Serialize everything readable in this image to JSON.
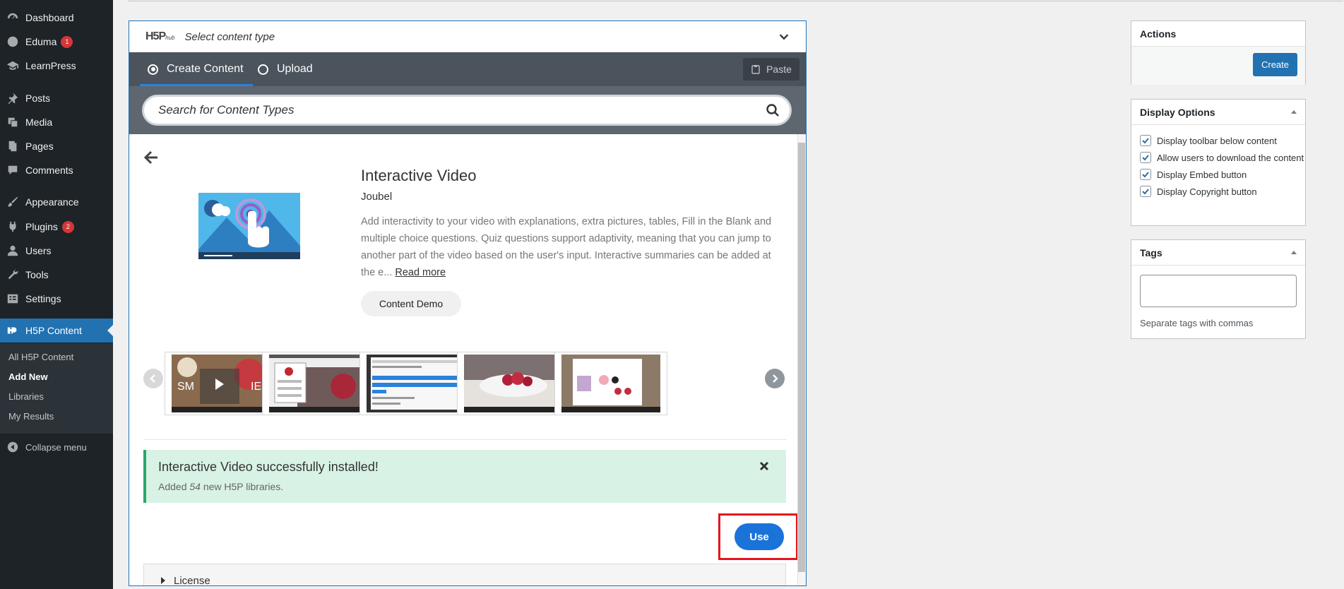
{
  "sidebar": {
    "items": [
      {
        "label": "Dashboard",
        "icon": "dashboard-icon"
      },
      {
        "label": "Eduma",
        "icon": "eduma-icon",
        "badge": "1"
      },
      {
        "label": "LearnPress",
        "icon": "learnpress-icon"
      },
      {
        "label": "Posts",
        "icon": "pin-icon"
      },
      {
        "label": "Media",
        "icon": "media-icon"
      },
      {
        "label": "Pages",
        "icon": "pages-icon"
      },
      {
        "label": "Comments",
        "icon": "comments-icon"
      },
      {
        "label": "Appearance",
        "icon": "brush-icon"
      },
      {
        "label": "Plugins",
        "icon": "plug-icon",
        "badge": "2"
      },
      {
        "label": "Users",
        "icon": "users-icon"
      },
      {
        "label": "Tools",
        "icon": "wrench-icon"
      },
      {
        "label": "Settings",
        "icon": "settings-icon"
      },
      {
        "label": "H5P Content",
        "icon": "h5p-icon"
      }
    ],
    "submenu": [
      "All H5P Content",
      "Add New",
      "Libraries",
      "My Results"
    ],
    "collapse_label": "Collapse menu"
  },
  "hub": {
    "logo_text": "H5P",
    "logo_sub": "hub",
    "title": "Select content type",
    "tabs": [
      {
        "label": "Create Content",
        "selected": true
      },
      {
        "label": "Upload",
        "selected": false
      }
    ],
    "paste_label": "Paste",
    "search_placeholder": "Search for Content Types"
  },
  "detail": {
    "title": "Interactive Video",
    "owner": "Joubel",
    "description": "Add interactivity to your video with explanations, extra pictures, tables, Fill in the Blank and multiple choice questions. Quiz questions support adaptivity, meaning that you can jump to another part of the video based on the user's input. Interactive summaries can be added at the e...",
    "read_more": "Read more",
    "demo_label": "Content Demo",
    "notice_title": "Interactive Video successfully installed!",
    "notice_prefix": "Added ",
    "notice_count": "54",
    "notice_suffix": " new H5P libraries.",
    "use_label": "Use",
    "license_label": "License"
  },
  "panels": {
    "actions_title": "Actions",
    "create_label": "Create",
    "display_title": "Display Options",
    "options": [
      {
        "label": "Display toolbar below content",
        "checked": true
      },
      {
        "label": "Allow users to download the content",
        "checked": true
      },
      {
        "label": "Display Embed button",
        "checked": true
      },
      {
        "label": "Display Copyright button",
        "checked": true
      }
    ],
    "tags_title": "Tags",
    "tags_hint": "Separate tags with commas"
  },
  "colors": {
    "sidebar_bg": "#1d2327",
    "accent": "#2271b1",
    "success_bg": "#d8f2e5",
    "highlight": "#e5151d",
    "use_button": "#1a73d9"
  }
}
